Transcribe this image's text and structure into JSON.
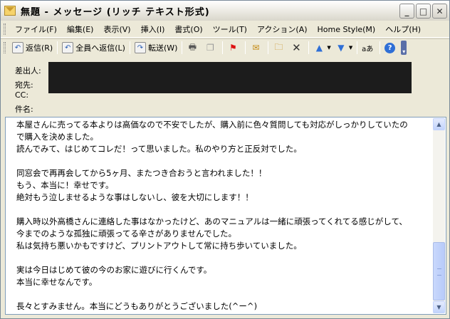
{
  "window": {
    "title": "無題 - メッセージ (リッチ テキスト形式)"
  },
  "title_buttons": {
    "minimize": "_",
    "maximize": "□",
    "close": "✕"
  },
  "menu": {
    "items": [
      "ファイル(F)",
      "編集(E)",
      "表示(V)",
      "挿入(I)",
      "書式(O)",
      "ツール(T)",
      "アクション(A)",
      "Home Style(M)",
      "ヘルプ(H)"
    ]
  },
  "toolbar": {
    "reply": "返信(R)",
    "reply_all": "全員へ返信(L)",
    "forward": "転送(W)",
    "icons": {
      "reply": "reply-icon",
      "reply_all": "reply-all-icon",
      "forward": "forward-icon",
      "print": "print-icon",
      "copy": "copy-icon",
      "flag": "flag-icon",
      "address_book": "address-book-icon",
      "move": "move-to-folder-icon",
      "delete": "delete-icon",
      "previous": "previous-item-icon",
      "next": "next-item-icon",
      "translate": "translate-icon",
      "help": "help-icon"
    }
  },
  "header": {
    "from_label": "差出人:",
    "to_label": "宛先:",
    "cc_label": "CC:",
    "subject_label": "件名:"
  },
  "message": {
    "lines": [
      "本屋さんに売ってる本よりは高価なので不安でしたが、購入前に色々質問しても対応がしっかりしていたの",
      "で購入を決めました。",
      "読んでみて、はじめてコレだ！って思いました。私のやり方と正反対でした。",
      "",
      "同窓会で再再会してから5ヶ月、またつき合おうと言われました！！",
      "もう、本当に！幸せです。",
      "絶対もう泣しませるような事はしないし、彼を大切にします！！",
      "",
      "購入時以外高橋さんに連絡した事はなかったけど、あのマニュアルは一緒に頑張ってくれてる感じがして、",
      "今までのような孤独に頑張ってる辛さがありませんでした。",
      "私は気持ち悪いかもですけど、プリントアウトして常に持ち歩いていました。",
      "",
      "実は今日はじめて彼の今のお家に遊びに行くんです。",
      "本当に幸せなんです。",
      "",
      "長々とすみません。本当にどうもありがとうございました(^ー^)"
    ]
  },
  "colors": {
    "chrome": "#ece9d8",
    "body_border": "#7f9db9",
    "redaction": "#1c1c1c"
  }
}
